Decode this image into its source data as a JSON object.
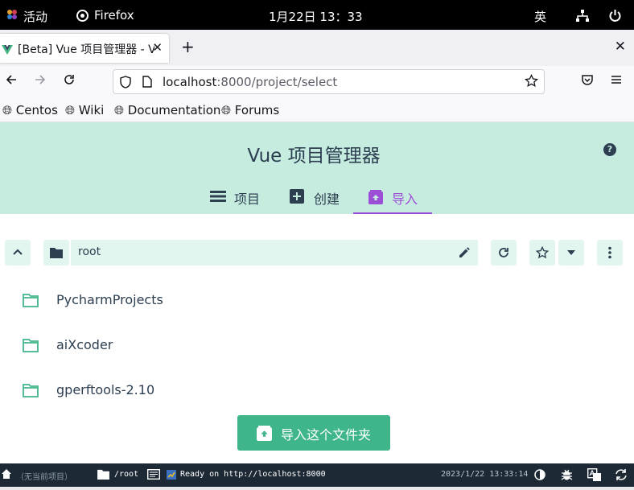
{
  "system_bar": {
    "activities": "活动",
    "app_name": "Firefox",
    "clock": "1月22日  13：33",
    "input_method": "英"
  },
  "browser": {
    "tab_title": "[Beta] Vue 项目管理器 - V",
    "url_host": "localhost",
    "url_rest": ":8000/project/select",
    "bookmarks": [
      "Centos",
      "Wiki",
      "Documentation",
      "Forums"
    ]
  },
  "app": {
    "title": "Vue 项目管理器",
    "help": "?",
    "tabs": [
      {
        "label": "项目",
        "active": false
      },
      {
        "label": "创建",
        "active": false
      },
      {
        "label": "导入",
        "active": true
      }
    ],
    "current_path": "root",
    "folders": [
      "PycharmProjects",
      "aiXcoder",
      "gperftools-2.10"
    ],
    "import_button": "导入这个文件夹",
    "accent_color": "#3fb68a",
    "active_tab_color": "#9c4fd6"
  },
  "status_bar": {
    "project": "（无当前项目）",
    "path": "/root",
    "log": "Ready on http://localhost:8000",
    "timestamp": "2023/1/22 13:33:14"
  }
}
